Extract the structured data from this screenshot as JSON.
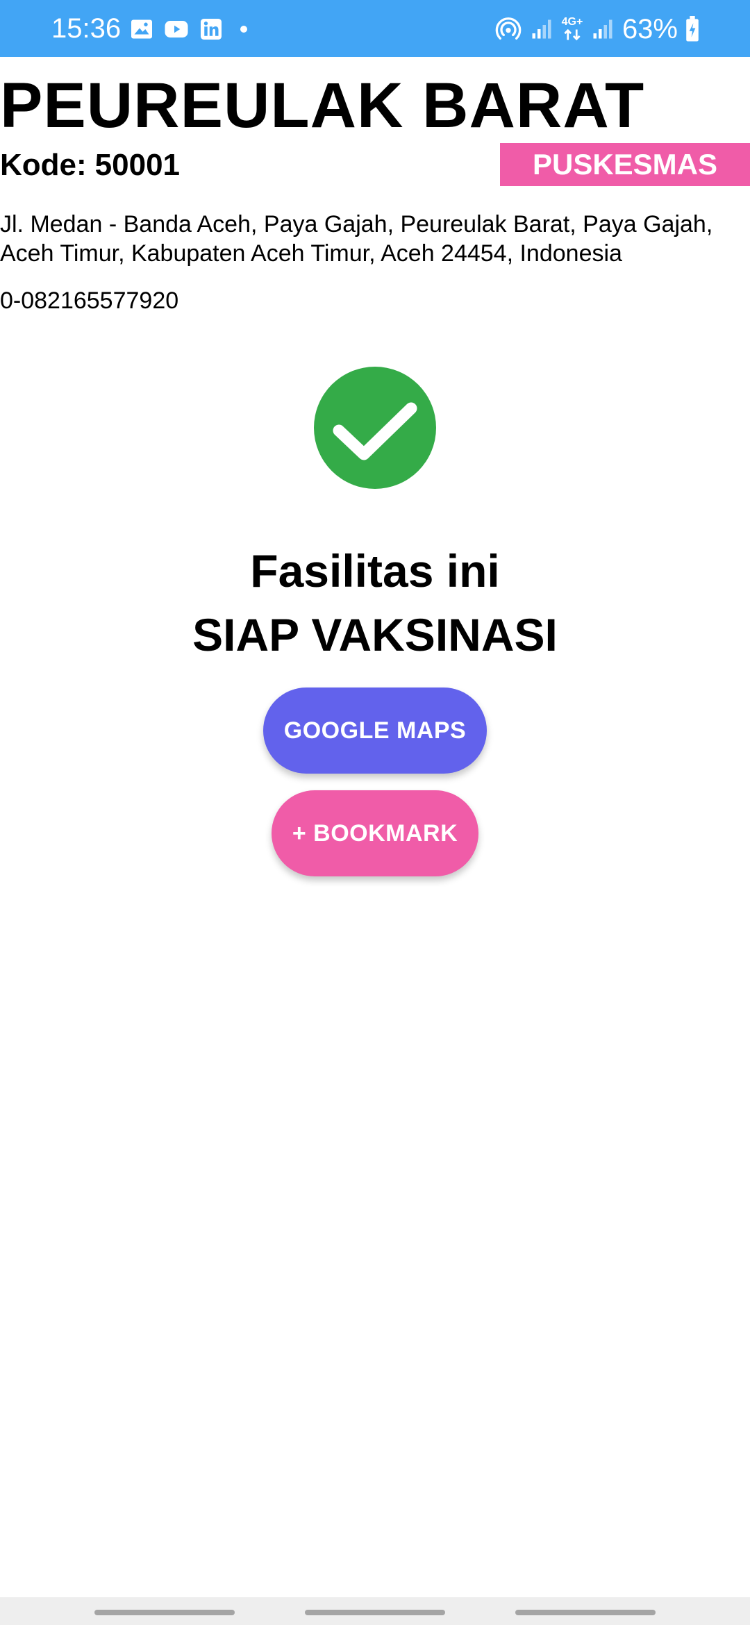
{
  "status_bar": {
    "time": "15:36",
    "battery": "63%",
    "network": "4G+",
    "icons_left": [
      "gallery-icon",
      "youtube-icon",
      "linkedin-icon",
      "notification-dot-icon"
    ],
    "icons_right": [
      "hotspot-icon",
      "signal-icon",
      "data-arrows-icon",
      "signal-icon",
      "battery-charging-icon"
    ],
    "background": "#42a5f5"
  },
  "facility": {
    "name": "PEUREULAK BARAT",
    "code_label": "Kode:",
    "code": "50001",
    "type": "PUSKESMAS",
    "address": "Jl. Medan - Banda Aceh, Paya Gajah, Peureulak Barat, Paya Gajah, Aceh Timur, Kabupaten Aceh Timur, Aceh 24454, Indonesia",
    "phone": "0-082165577920"
  },
  "status": {
    "icon": "check-circle-icon",
    "line1": "Fasilitas ini",
    "line2": "SIAP VAKSINASI",
    "color": "#34ab48"
  },
  "actions": {
    "maps_label": "GOOGLE MAPS",
    "bookmark_label": "+ BOOKMARK",
    "maps_color": "#6262ec",
    "bookmark_color": "#f05ca8"
  }
}
